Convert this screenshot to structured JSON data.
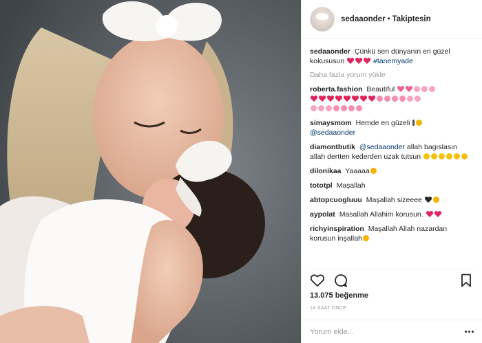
{
  "post": {
    "username": "sedaaonder",
    "separator": "•",
    "follow_status": "Takiptesin",
    "caption": {
      "user": "sedaaonder",
      "text": "Çünkü sen dünyanın en güzel kokususun",
      "hashtag": "#tanemyade"
    },
    "load_more": "Daha fazla yorum yükle",
    "comments": [
      {
        "user": "roberta.fashion",
        "text": "Beautiful"
      },
      {
        "user": "simaysmom",
        "text": "Hemde en güzeli",
        "mention": "@sedaaonder"
      },
      {
        "user": "diamontbutik",
        "mention": "@sedaaonder",
        "text": "allah bagıslasın allah dertten kederden uzak tutsun"
      },
      {
        "user": "dilonikaa",
        "text": "Yaaaaa"
      },
      {
        "user": "tototpl",
        "text": "Maşallah"
      },
      {
        "user": "abtopcuogluuu",
        "text": "Maşallah sizeeee"
      },
      {
        "user": "aypolat",
        "text": "Masallah Allahim korusun."
      },
      {
        "user": "richyinspiration",
        "text": "Maşallah Allah nazardan korusun inşallah"
      }
    ],
    "likes": "13.075 beğenme",
    "time": "14 SAAT ÖNCE",
    "comment_placeholder": "Yorum ekle..."
  },
  "icons": {
    "like": "heart-outline-icon",
    "comment": "comment-bubble-icon",
    "save": "bookmark-icon",
    "more": "more-dots-icon"
  },
  "colors": {
    "text": "#262626",
    "muted": "#999999",
    "link": "#003569",
    "heart_red": "#e0245e",
    "pink": "#f78fb3"
  }
}
